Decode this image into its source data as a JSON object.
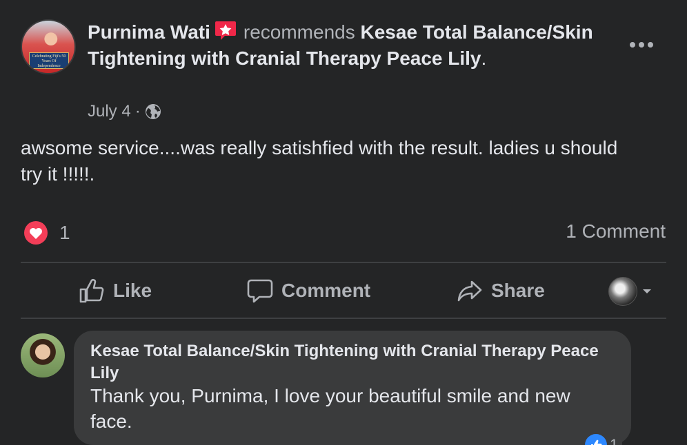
{
  "post": {
    "author": "Purnima Wati",
    "verb": "recommends",
    "page": "Kesae Total Balance/Skin Tightening with Cranial Therapy Peace Lily",
    "period": ".",
    "date": "July 4",
    "separator": "·",
    "avatar_banner": "Celebrating Fiji's 50 Years Of Independence",
    "body": "awsome service....was really satishfied with the result. ladies u should try it !!!!!."
  },
  "reactions": {
    "love_count": "1",
    "comment_count": "1 Comment"
  },
  "actions": {
    "like": "Like",
    "comment": "Comment",
    "share": "Share"
  },
  "comment": {
    "author": "Kesae Total Balance/Skin Tightening with Cranial Therapy Peace Lily",
    "text": "Thank you, Purnima, I love your beautiful smile and new face.",
    "like_count": "1"
  },
  "colors": {
    "background": "#242526",
    "primary_text": "#e4e6eb",
    "secondary_text": "#b0b3b8",
    "love_red": "#f33e58",
    "like_blue": "#2d88ff",
    "bubble": "#3a3b3c"
  },
  "icons": [
    "recommend-icon",
    "globe-icon",
    "more-icon",
    "love-reaction-icon",
    "like-icon",
    "comment-icon",
    "share-icon",
    "caret-down-icon",
    "like-reaction-icon"
  ]
}
